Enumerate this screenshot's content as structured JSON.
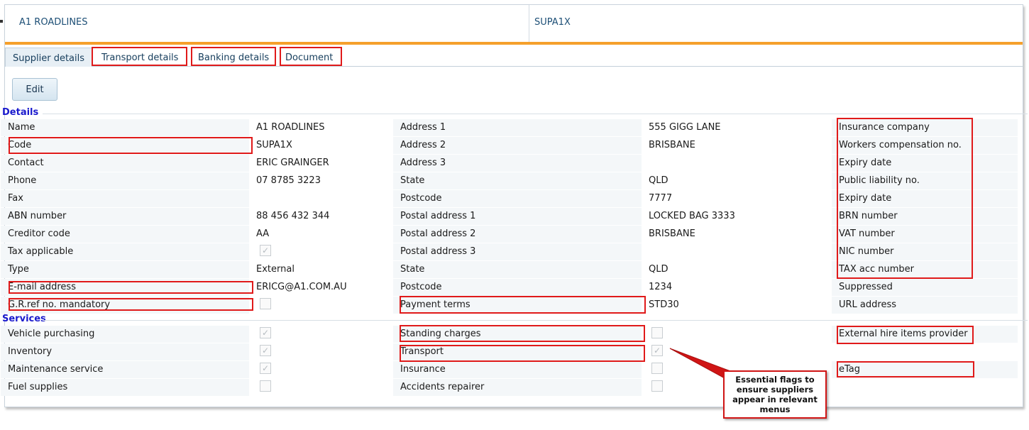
{
  "header": {
    "supplier_name": "A1 ROADLINES",
    "supplier_code": "SUPA1X"
  },
  "tabs": [
    {
      "label": "Supplier details",
      "active": true
    },
    {
      "label": "Transport details",
      "active": false
    },
    {
      "label": "Banking details",
      "active": false
    },
    {
      "label": "Document",
      "active": false
    }
  ],
  "toolbar": {
    "edit_label": "Edit"
  },
  "details": {
    "title": "Details",
    "rows": [
      {
        "l1": "Name",
        "v1": "A1 ROADLINES",
        "l2": "Address 1",
        "v2": "555 GIGG LANE",
        "l3": "Insurance company"
      },
      {
        "l1": "Code",
        "v1": "SUPA1X",
        "l2": "Address 2",
        "v2": "BRISBANE",
        "l3": "Workers compensation no."
      },
      {
        "l1": "Contact",
        "v1": "ERIC GRAINGER",
        "l2": "Address 3",
        "v2": "",
        "l3": "Expiry date"
      },
      {
        "l1": "Phone",
        "v1": "07 8785 3223",
        "l2": "State",
        "v2": "QLD",
        "l3": "Public liability no."
      },
      {
        "l1": "Fax",
        "v1": "",
        "l2": "Postcode",
        "v2": "7777",
        "l3": "Expiry date"
      },
      {
        "l1": "ABN number",
        "v1": "88 456 432 344",
        "l2": "Postal address 1",
        "v2": "LOCKED BAG 3333",
        "l3": "BRN number"
      },
      {
        "l1": "Creditor code",
        "v1": "AA",
        "l2": "Postal address 2",
        "v2": "BRISBANE",
        "l3": "VAT number"
      },
      {
        "l1": "Tax applicable",
        "v1": "",
        "check1": true,
        "l2": "Postal address 3",
        "v2": "",
        "l3": "NIC number"
      },
      {
        "l1": "Type",
        "v1": "External",
        "l2": "State",
        "v2": "QLD",
        "l3": "TAX acc number"
      },
      {
        "l1": "E-mail address",
        "v1": "ERICG@A1.COM.AU",
        "l2": "Postcode",
        "v2": "1234",
        "l3": "Suppressed"
      },
      {
        "l1": "G.R.ref no. mandatory",
        "v1": "",
        "check1": false,
        "l2": "Payment terms",
        "v2": "STD30",
        "l3": "URL address"
      }
    ]
  },
  "services": {
    "title": "Services",
    "rows": [
      {
        "l1": "Vehicle purchasing",
        "c1": true,
        "l2": "Standing charges",
        "c2": false,
        "l3": "External hire items provider"
      },
      {
        "l1": "Inventory",
        "c1": true,
        "l2": "Transport",
        "c2": true,
        "l3": ""
      },
      {
        "l1": "Maintenance service",
        "c1": true,
        "l2": "Insurance",
        "c2": false,
        "l3": "eTag"
      },
      {
        "l1": "Fuel supplies",
        "c1": false,
        "l2": "Accidents repairer",
        "c2": false,
        "l3": ""
      }
    ]
  },
  "callout": {
    "text": "Essential flags to ensure suppliers appear in relevant menus"
  },
  "colors": {
    "accent": "#f5a02b",
    "highlight": "#e01a1a",
    "section": "#1a1acd"
  }
}
